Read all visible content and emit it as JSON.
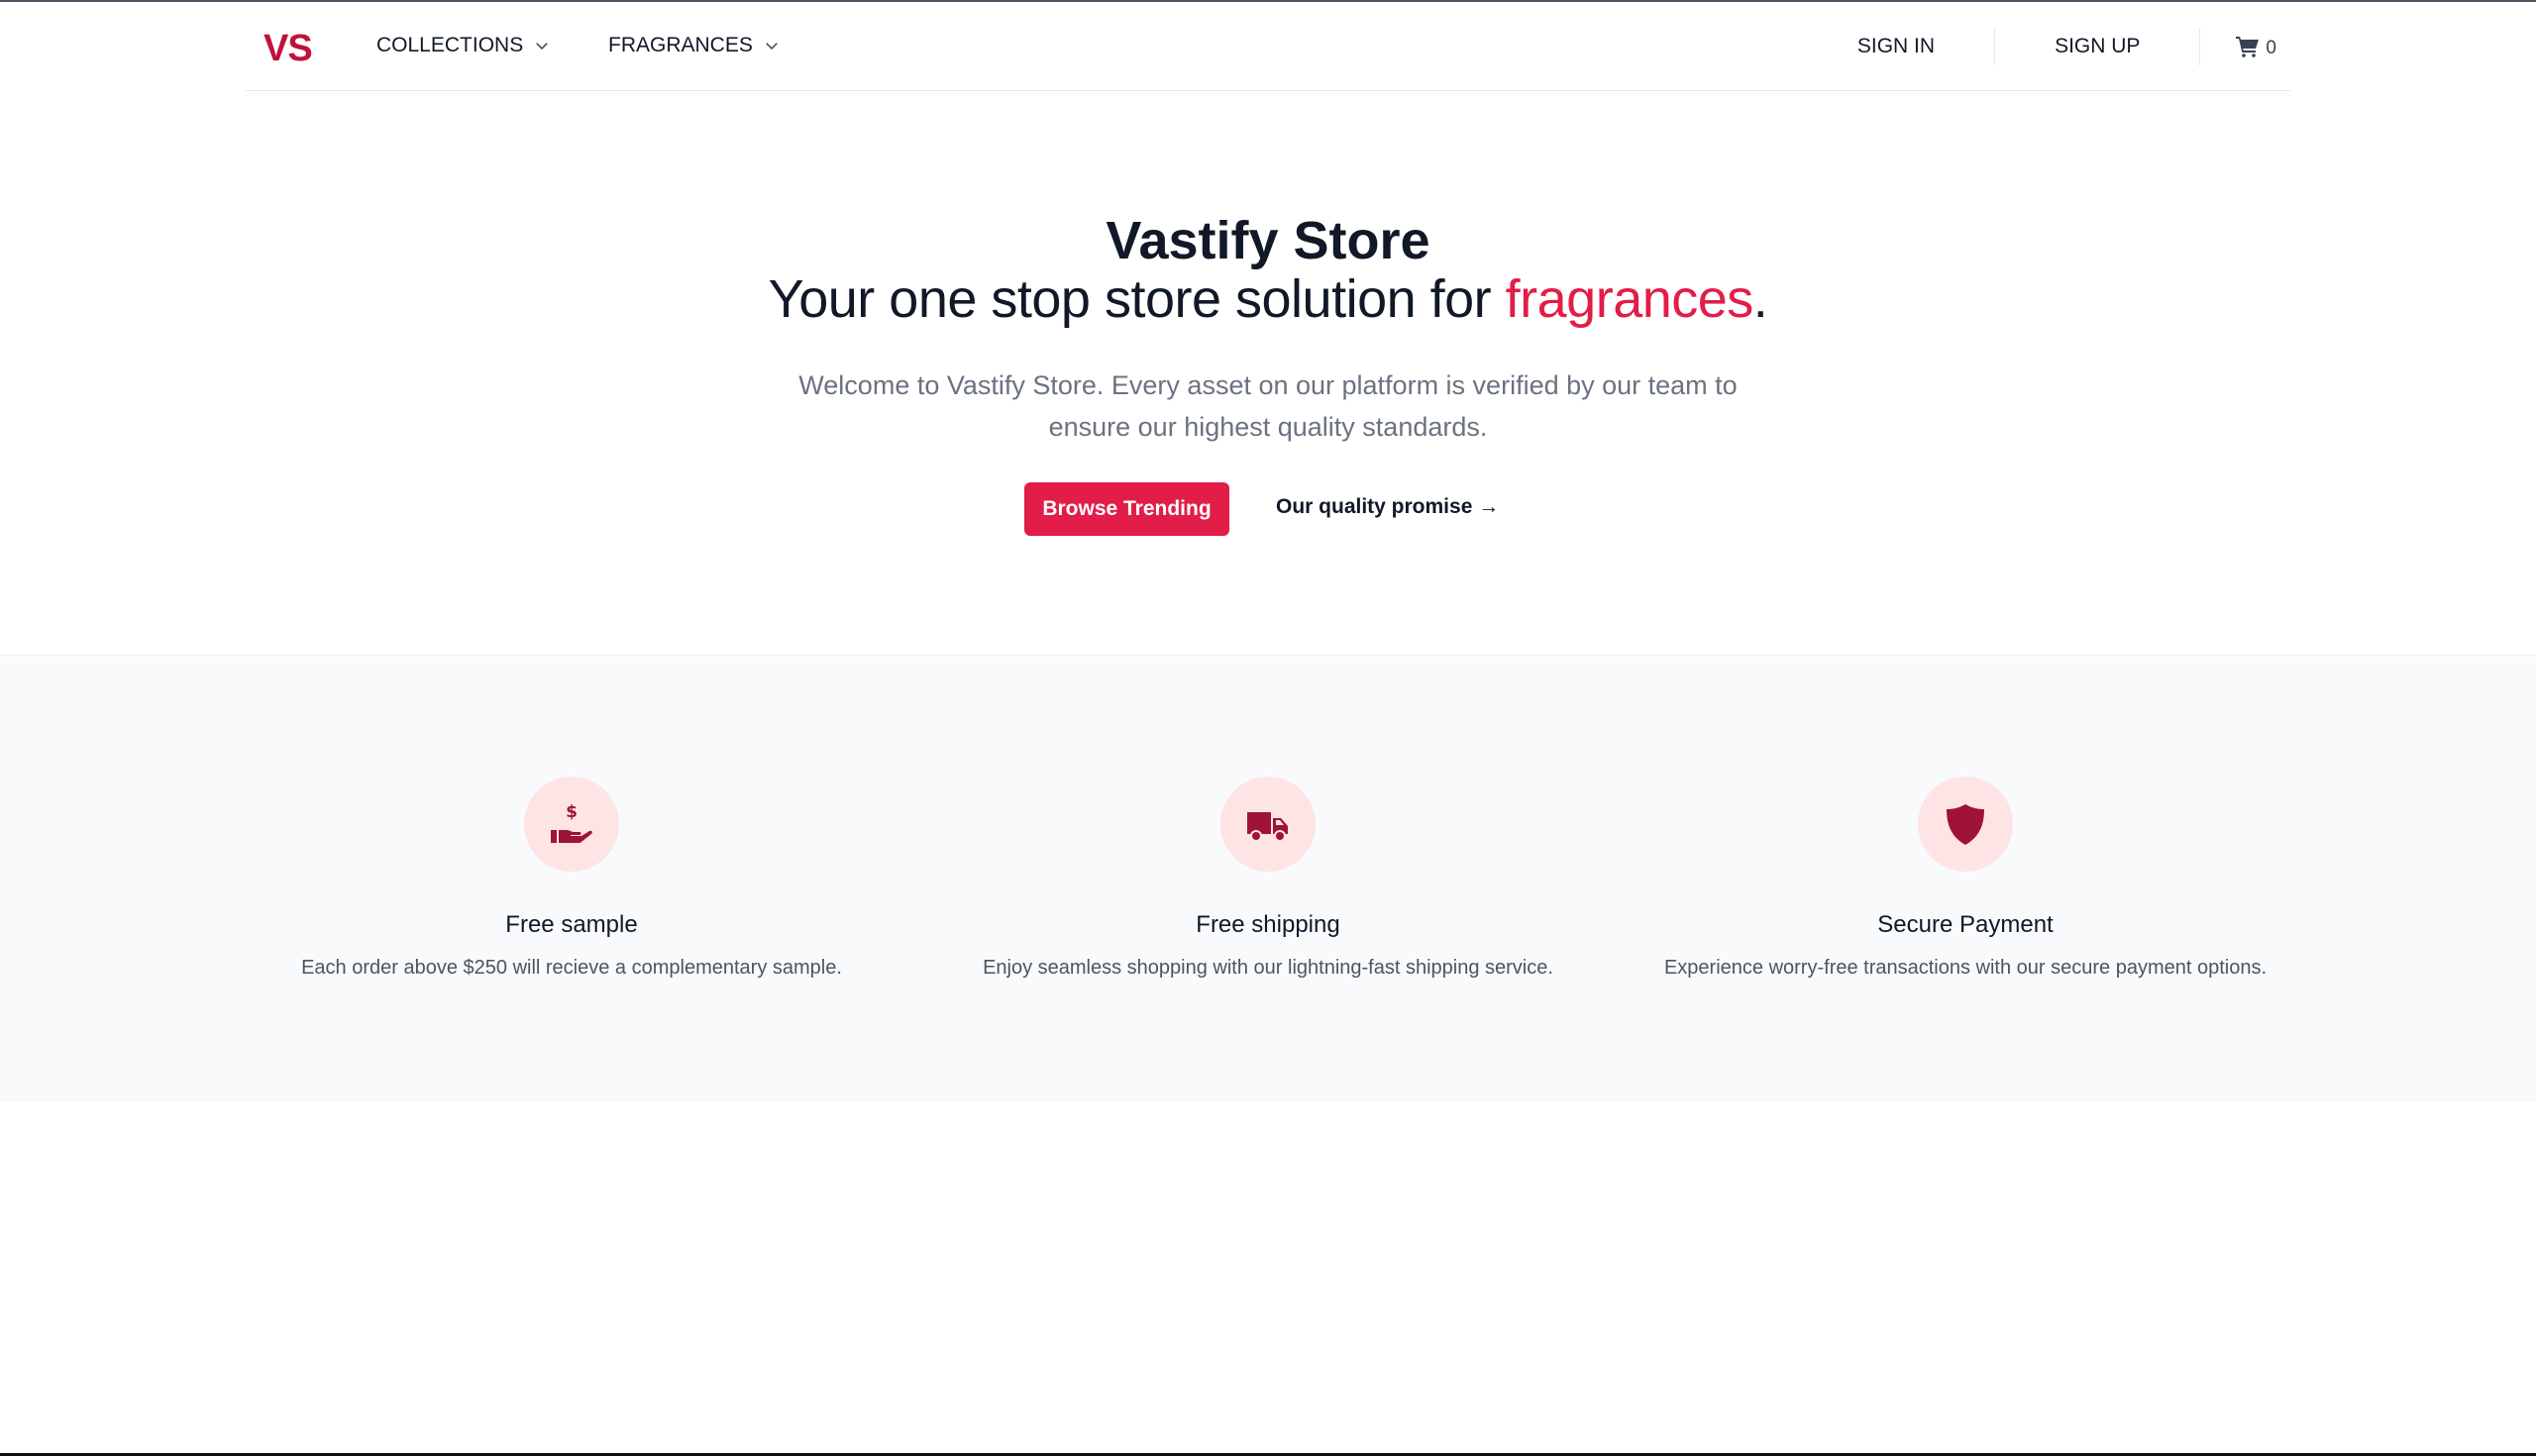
{
  "nav": {
    "logo": "VS",
    "collections": "COLLECTIONS",
    "fragrances": "FRAGRANCES",
    "sign_in": "SIGN IN",
    "sign_up": "SIGN UP",
    "cart_count": "0"
  },
  "hero": {
    "title": "Vastify Store",
    "subtitle_prefix": "Your one stop store solution for ",
    "subtitle_accent": "fragrances",
    "subtitle_suffix": ".",
    "description": "Welcome to Vastify Store. Every asset on our platform is verified by our team to ensure our highest quality standards.",
    "primary_button": "Browse Trending",
    "secondary_link": "Our quality promise →"
  },
  "features": [
    {
      "icon": "hand-dollar-icon",
      "title": "Free sample",
      "description": "Each order above $250 will recieve a complementary sample."
    },
    {
      "icon": "truck-icon",
      "title": "Free shipping",
      "description": "Enjoy seamless shopping with our lightning-fast shipping service."
    },
    {
      "icon": "shield-icon",
      "title": "Secure Payment",
      "description": "Experience worry-free transactions with our secure payment options."
    }
  ],
  "colors": {
    "accent": "#e11d48",
    "logo": "#be123c",
    "icon": "#9f1239",
    "icon_bg": "#ffe4e6",
    "features_bg": "#f9fafb"
  }
}
